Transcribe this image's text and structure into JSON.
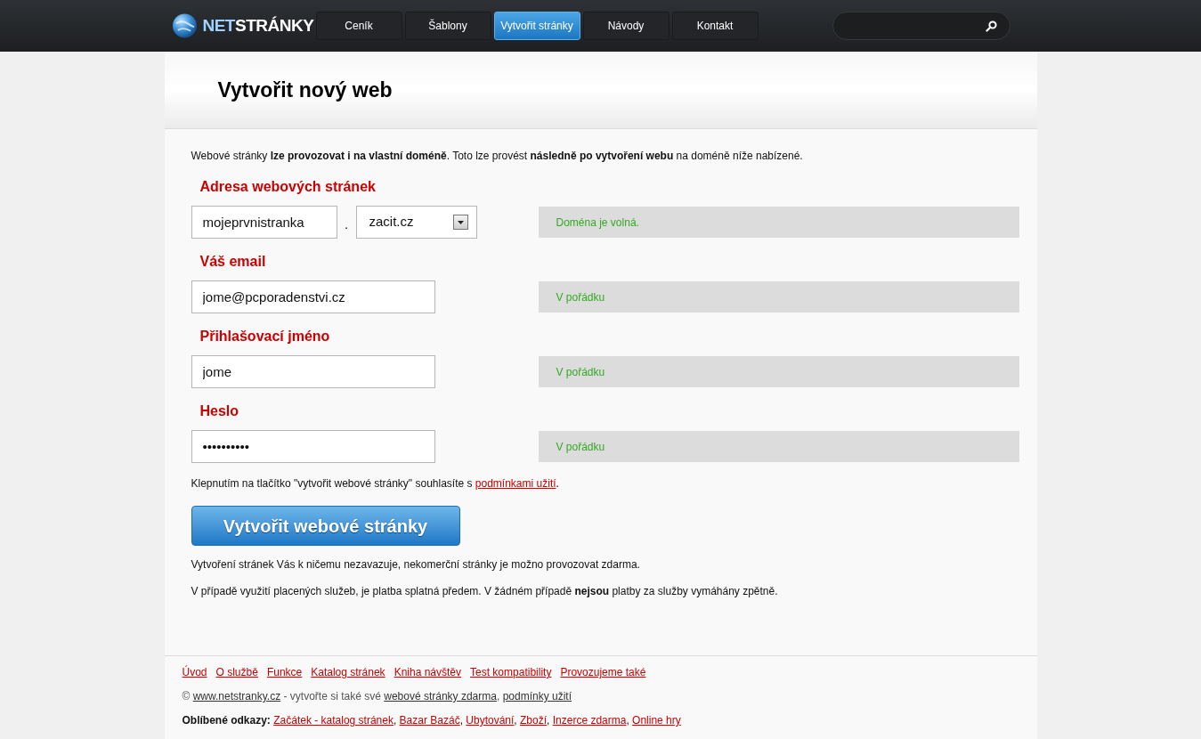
{
  "header": {
    "logo": {
      "prefix": "NET",
      "suffix": "STRÁNKY"
    },
    "nav": [
      {
        "label": "Ceník",
        "selected": false
      },
      {
        "label": "Šablony",
        "selected": false
      },
      {
        "label": "Vytvořit stránky",
        "selected": true
      },
      {
        "label": "Návody",
        "selected": false
      },
      {
        "label": "Kontakt",
        "selected": false
      }
    ]
  },
  "title": "Vytvořit nový web",
  "intro": "Webové stránky **lze provozovat i na vlastní doméně**. Toto lze provést **následně po vytvoření webu** na doméně níže nabízené.",
  "fields": [
    {
      "kind": "domain",
      "label": "Adresa webových stránek",
      "value": "mojeprvnistranka",
      "separator": ".",
      "domain": "zacit.cz",
      "status": "Doména je volná."
    },
    {
      "kind": "text",
      "label": "Váš email",
      "value": "jome@pcporadenstvi.cz",
      "status": "V pořádku"
    },
    {
      "kind": "text",
      "label": "Přihlašovací jméno",
      "value": "jome",
      "status": "V pořádku"
    },
    {
      "kind": "text",
      "label": "Heslo",
      "value": "••••••••••",
      "status": "V pořádku"
    }
  ],
  "agreement": {
    "before": "Klepnutím na tlačítko \"vytvořit webové stránky\" souhlasíte s ",
    "link": "podmínkami užití",
    "after": "."
  },
  "submit": "Vytvořit webové stránky",
  "notes": [
    "Vytvoření stránek Vás k ničemu nezavazuje, nekomerční stránky je možno provozovat zdarma.",
    "V případě využití placených služeb, je platba splatná předem. V žádném případě **nejsou** platby za služby vymáhány zpětně."
  ],
  "footer": {
    "links": [
      "Úvod",
      "O službě",
      "Funkce",
      "Katalog stránek",
      "Kniha návštěv",
      "Test kompatibility",
      "Provozujeme také"
    ],
    "copyright": {
      "symbol": "©",
      "site": "www.netstranky.cz",
      "text": " - vytvořte si také své ",
      "link1": "webové stránky zdarma",
      "sep": ", ",
      "link2": "podmínky užití"
    },
    "favorites": {
      "label": "Oblíbené odkazy:",
      "separator": ", ",
      "links": [
        "Začátek - katalog stránek",
        "Bazar Bazáč",
        "Ubytování",
        "Zboží",
        "Inzerce zdarma",
        "Online hry"
      ]
    }
  }
}
